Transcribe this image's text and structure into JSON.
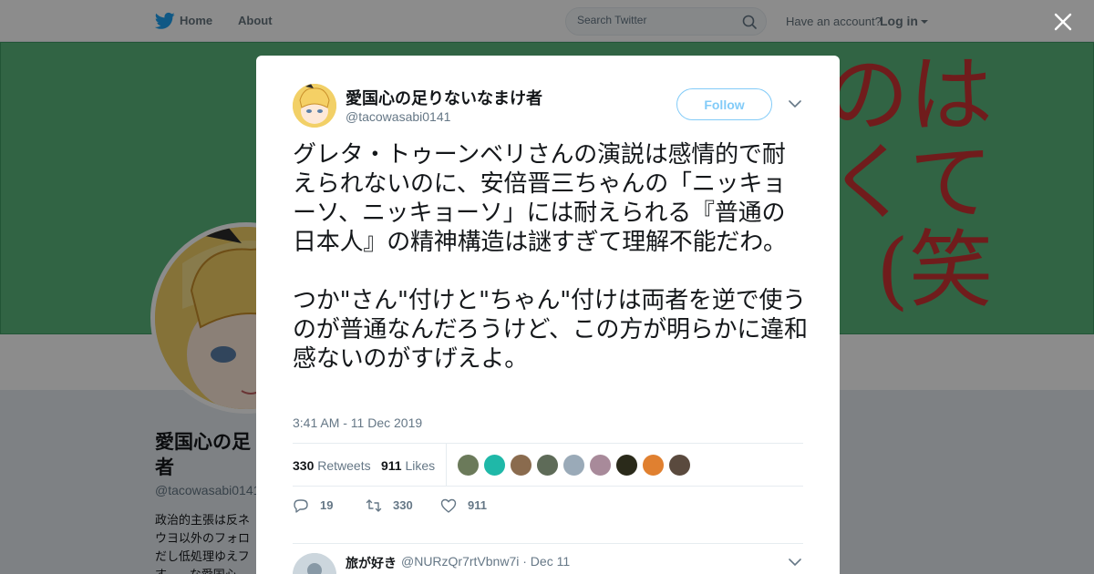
{
  "nav": {
    "home_label": "Home",
    "about_label": "About",
    "search_placeholder": "Search Twitter",
    "have_account": "Have an account?",
    "login_label": "Log in"
  },
  "profile": {
    "name": "愛国心の足りないなまけ者",
    "name_partial": "愛国心の足\n者",
    "handle": "@tacowasabi0141",
    "bio_partial": "政治的主張は反ネ\nウヨ以外のフォロ\nだし低処理ゆえフ\nす。…な愛国心",
    "banner_text": "のは\nくて\n(笑"
  },
  "tweet": {
    "author_name": "愛国心の足りないなまけ者",
    "author_handle": "@tacowasabi0141",
    "follow_label": "Follow",
    "text": "グレタ・トゥーンベリさんの演説は感情的で耐えられないのに、安倍晋三ちゃんの「ニッキョーソ、ニッキョーソ」には耐えられる『普通の日本人』の精神構造は謎すぎて理解不能だわ。\n\nつか\"さん\"付けと\"ちゃん\"付けは両者を逆で使うのが普通なんだろうけど、この方が明らかに違和感ないのがすげえよ。",
    "timestamp": "3:41 AM - 11 Dec 2019",
    "retweets_count": "330",
    "retweets_label": "Retweets",
    "likes_count": "911",
    "likes_label": "Likes",
    "reply_count": "19",
    "retweet_action_count": "330",
    "like_action_count": "911"
  },
  "likers": [
    {
      "color": "#6b7a5a"
    },
    {
      "color": "#1fb8a8"
    },
    {
      "color": "#8a6b4e"
    },
    {
      "color": "#5e6b58"
    },
    {
      "color": "#9aaab8"
    },
    {
      "color": "#a88a9a"
    },
    {
      "color": "#2a2a1a"
    },
    {
      "color": "#e08030"
    },
    {
      "color": "#5a4a3e"
    }
  ],
  "reply": {
    "name": "旅が好き",
    "handle": "@NURzQr7rtVbnw7i · Dec 11"
  },
  "colors": {
    "accent": "#1da1f2",
    "banner": "#5ab77d",
    "banner_text": "#cc3333"
  }
}
